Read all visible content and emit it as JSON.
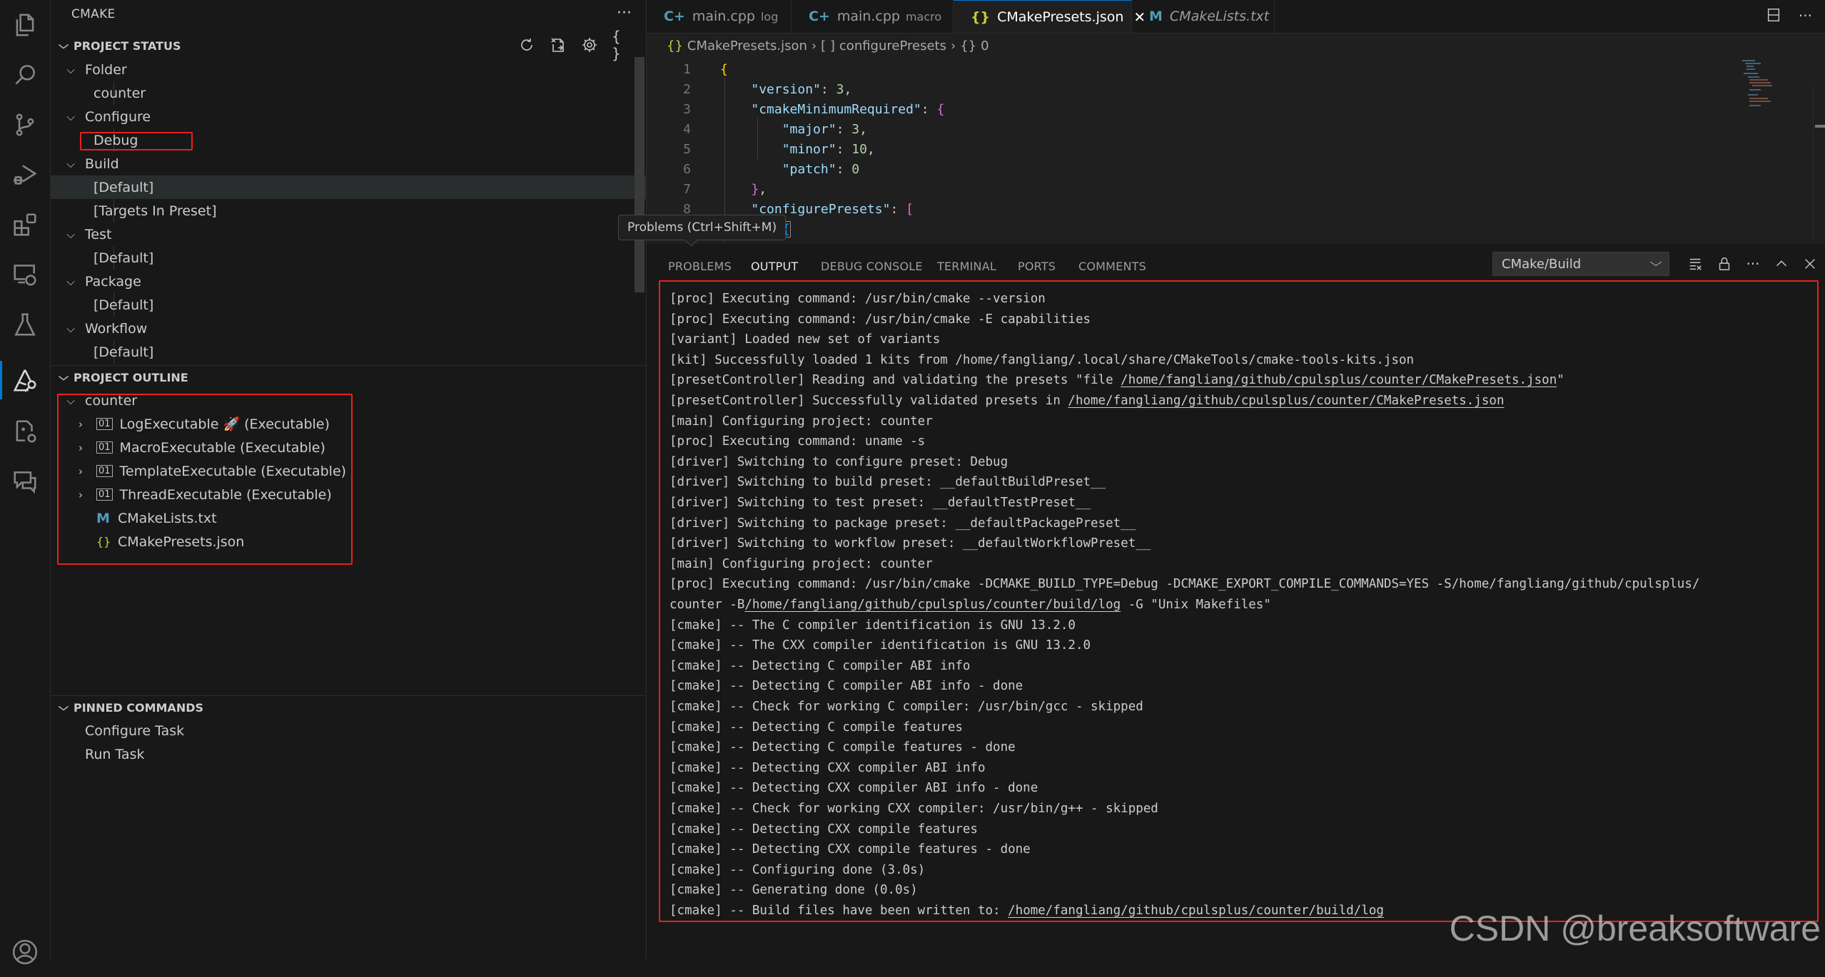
{
  "activity_bar": {
    "items": [
      {
        "name": "explorer-icon",
        "label": "Explorer"
      },
      {
        "name": "search-icon",
        "label": "Search"
      },
      {
        "name": "source-control-icon",
        "label": "Source Control"
      },
      {
        "name": "run-debug-icon",
        "label": "Run and Debug"
      },
      {
        "name": "extensions-icon",
        "label": "Extensions"
      },
      {
        "name": "remote-explorer-icon",
        "label": "Remote Explorer"
      },
      {
        "name": "testing-icon",
        "label": "Testing"
      },
      {
        "name": "cmake-icon",
        "label": "CMake",
        "active": true
      },
      {
        "name": "cpp-config-icon",
        "label": "C/C++"
      },
      {
        "name": "comments-icon",
        "label": "Comments"
      }
    ],
    "bottom": [
      {
        "name": "account-icon",
        "label": "Accounts"
      }
    ]
  },
  "sidebar": {
    "title": "CMAKE",
    "more": "···",
    "project_status": {
      "header": "PROJECT STATUS",
      "groups": [
        {
          "label": "Folder",
          "children": [
            "counter"
          ]
        },
        {
          "label": "Configure",
          "children": [
            "Debug"
          ]
        },
        {
          "label": "Build",
          "children": [
            "[Default]",
            "[Targets In Preset]"
          ]
        },
        {
          "label": "Test",
          "children": [
            "[Default]"
          ]
        },
        {
          "label": "Package",
          "children": [
            "[Default]"
          ]
        },
        {
          "label": "Workflow",
          "children": [
            "[Default]"
          ]
        }
      ],
      "actions": [
        "refresh-icon",
        "delete-cache-icon",
        "settings-icon",
        "json-icon"
      ]
    },
    "project_outline": {
      "header": "PROJECT OUTLINE",
      "root": "counter",
      "targets": [
        {
          "name": "LogExecutable",
          "badge": "🚀",
          "type": "(Executable)"
        },
        {
          "name": "MacroExecutable",
          "type": "(Executable)"
        },
        {
          "name": "TemplateExecutable",
          "type": "(Executable)"
        },
        {
          "name": "ThreadExecutable",
          "type": "(Executable)"
        }
      ],
      "files": [
        {
          "name": "CMakeLists.txt",
          "icon": "M"
        },
        {
          "name": "CMakePresets.json",
          "icon": "{}"
        }
      ]
    },
    "pinned_commands": {
      "header": "PINNED COMMANDS",
      "items": [
        "Configure Task",
        "Run Task"
      ]
    }
  },
  "editor": {
    "tabs": [
      {
        "icon": "C+",
        "label": "main.cpp",
        "desc": "log"
      },
      {
        "icon": "C+",
        "label": "main.cpp",
        "desc": "macro"
      },
      {
        "icon": "{}",
        "label": "CMakePresets.json",
        "active": true,
        "close": "✕"
      },
      {
        "icon": "M",
        "label": "CMakeLists.txt",
        "italic": true
      }
    ],
    "breadcrumb": [
      {
        "icon": "{}",
        "label": "CMakePresets.json"
      },
      {
        "icon": "[ ]",
        "label": "configurePresets"
      },
      {
        "icon": "{}",
        "label": "0"
      }
    ],
    "line_numbers": [
      "1",
      "2",
      "3",
      "4",
      "5",
      "6",
      "7",
      "8"
    ],
    "code": {
      "l1": "{",
      "l2_key": "\"version\"",
      "l2_val": "3",
      "l3_key": "\"cmakeMinimumRequired\"",
      "l3_brace": "{",
      "l4_key": "\"major\"",
      "l4_val": "3",
      "l5_key": "\"minor\"",
      "l5_val": "10",
      "l6_key": "\"patch\"",
      "l6_val": "0",
      "l7": "}",
      "l8_key": "\"configurePresets\"",
      "l8_brace": "[",
      "l9": "{"
    }
  },
  "tooltip": "Problems (Ctrl+Shift+M)",
  "panel": {
    "tabs": [
      "PROBLEMS",
      "OUTPUT",
      "DEBUG CONSOLE",
      "TERMINAL",
      "PORTS",
      "COMMENTS"
    ],
    "active_tab": "OUTPUT",
    "channel": "CMake/Build",
    "output": [
      {
        "text": "[proc] Executing command: /usr/bin/cmake --version"
      },
      {
        "text": "[proc] Executing command: /usr/bin/cmake -E capabilities"
      },
      {
        "text": "[variant] Loaded new set of variants"
      },
      {
        "text": "[kit] Successfully loaded 1 kits from /home/fangliang/.local/share/CMakeTools/cmake-tools-kits.json"
      },
      {
        "pre": "[presetController] Reading and validating the presets \"file ",
        "link": "/home/fangliang/github/cpulsplus/counter/CMakePresets.json",
        "post": "\""
      },
      {
        "pre": "[presetController] Successfully validated presets in ",
        "link": "/home/fangliang/github/cpulsplus/counter/CMakePresets.json",
        "post": ""
      },
      {
        "text": "[main] Configuring project: counter"
      },
      {
        "text": "[proc] Executing command: uname -s"
      },
      {
        "text": "[driver] Switching to configure preset: Debug"
      },
      {
        "text": "[driver] Switching to build preset: __defaultBuildPreset__"
      },
      {
        "text": "[driver] Switching to test preset: __defaultTestPreset__"
      },
      {
        "text": "[driver] Switching to package preset: __defaultPackagePreset__"
      },
      {
        "text": "[driver] Switching to workflow preset: __defaultWorkflowPreset__"
      },
      {
        "text": "[main] Configuring project: counter"
      },
      {
        "text": "[proc] Executing command: /usr/bin/cmake -DCMAKE_BUILD_TYPE=Debug -DCMAKE_EXPORT_COMPILE_COMMANDS=YES -S/home/fangliang/github/cpulsplus/"
      },
      {
        "pre": "counter -B",
        "link": "/home/fangliang/github/cpulsplus/counter/build/log",
        "post": " -G \"Unix Makefiles\""
      },
      {
        "text": "[cmake] -- The C compiler identification is GNU 13.2.0"
      },
      {
        "text": "[cmake] -- The CXX compiler identification is GNU 13.2.0"
      },
      {
        "text": "[cmake] -- Detecting C compiler ABI info"
      },
      {
        "text": "[cmake] -- Detecting C compiler ABI info - done"
      },
      {
        "text": "[cmake] -- Check for working C compiler: /usr/bin/gcc - skipped"
      },
      {
        "text": "[cmake] -- Detecting C compile features"
      },
      {
        "text": "[cmake] -- Detecting C compile features - done"
      },
      {
        "text": "[cmake] -- Detecting CXX compiler ABI info"
      },
      {
        "text": "[cmake] -- Detecting CXX compiler ABI info - done"
      },
      {
        "text": "[cmake] -- Check for working CXX compiler: /usr/bin/g++ - skipped"
      },
      {
        "text": "[cmake] -- Detecting CXX compile features"
      },
      {
        "text": "[cmake] -- Detecting CXX compile features - done"
      },
      {
        "text": "[cmake] -- Configuring done (3.0s)"
      },
      {
        "text": "[cmake] -- Generating done (0.0s)"
      },
      {
        "pre": "[cmake] -- Build files have been written to: ",
        "link": "/home/fangliang/github/cpulsplus/counter/build/log",
        "post": ""
      }
    ]
  },
  "watermark": "CSDN @breaksoftware",
  "colors": {
    "accent": "#0078d4",
    "highlight_box": "#e8211b",
    "json_key": "#9cdcfe",
    "json_number": "#b5cea8"
  }
}
